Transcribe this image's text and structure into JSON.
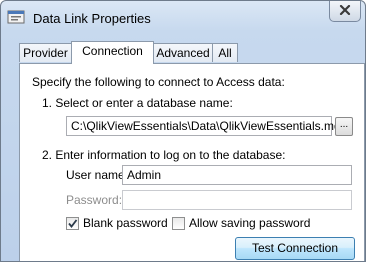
{
  "window": {
    "title": "Data Link Properties"
  },
  "tabs": [
    {
      "label": "Provider",
      "active": false
    },
    {
      "label": "Connection",
      "active": true
    },
    {
      "label": "Advanced",
      "active": false
    },
    {
      "label": "All",
      "active": false
    }
  ],
  "connection": {
    "intro": "Specify the following to connect to Access data:",
    "step1_label": "1. Select or enter a database name:",
    "database_path": "C:\\QlikViewEssentials\\Data\\QlikViewEssentials.mdb",
    "browse_label": "...",
    "step2_label": "2. Enter information to log on to the database:",
    "user_name_label": "User name:",
    "user_name_value": "Admin",
    "password_label": "Password:",
    "password_value": "",
    "blank_password_label": "Blank password",
    "blank_password_checked": true,
    "allow_saving_label": "Allow saving password",
    "allow_saving_checked": false
  },
  "buttons": {
    "test_connection": "Test Connection"
  },
  "colors": {
    "accent": "#3c7fb1",
    "close_x": "#3a3a3a"
  }
}
